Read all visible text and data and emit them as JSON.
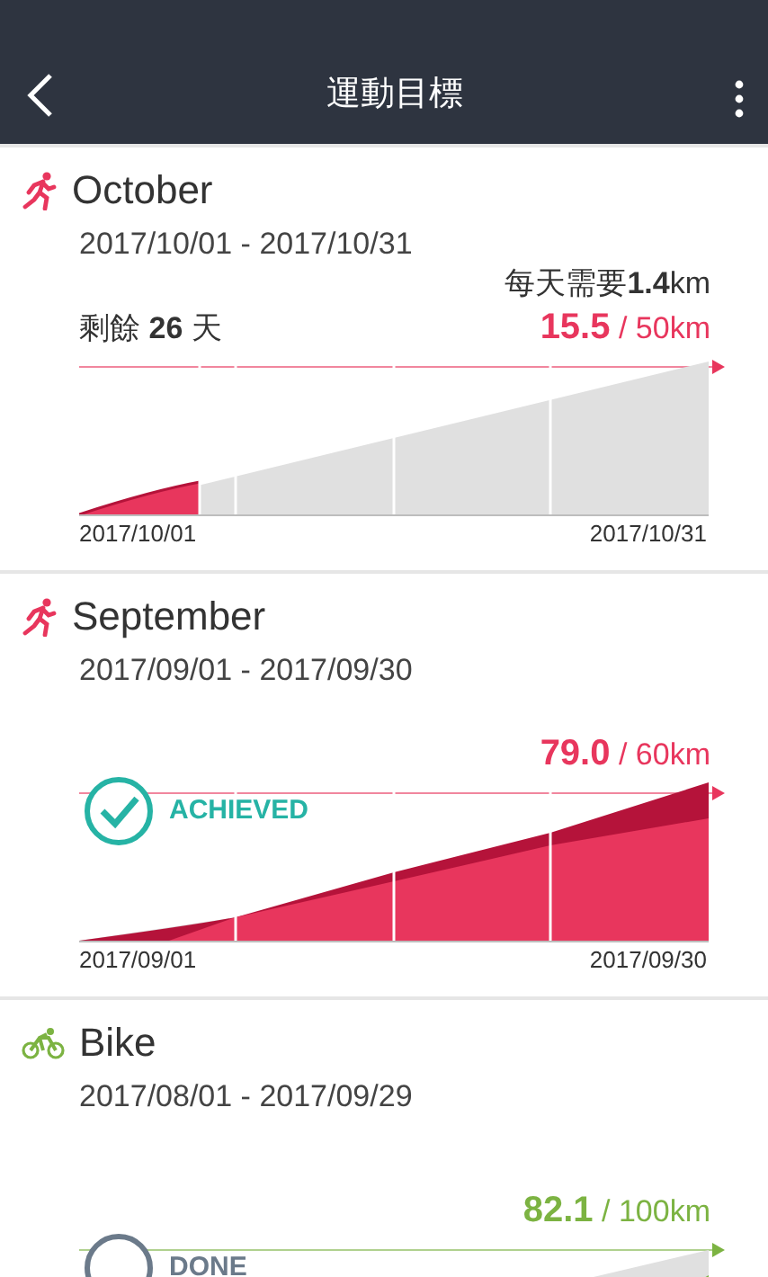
{
  "header": {
    "title": "運動目標"
  },
  "goals": [
    {
      "kind": "run",
      "color": "#e8365d",
      "name": "October",
      "dates": "2017/10/01 - 2017/10/31",
      "daily": "每天需要**1.4**km",
      "remaining": "剩餘 **26** 天",
      "current": "15.5",
      "target": " / 50km",
      "chart": {
        "kind": "partial"
      },
      "start": "2017/10/01",
      "end": "2017/10/31"
    },
    {
      "kind": "run",
      "color": "#e8365d",
      "name": "September",
      "dates": "2017/09/01 - 2017/09/30",
      "current": "79.0",
      "target": " / 60km",
      "badge": {
        "kind": "achieved",
        "label": "ACHIEVED"
      },
      "chart": {
        "kind": "exceeded"
      },
      "start": "2017/09/01",
      "end": "2017/09/30"
    },
    {
      "kind": "bike",
      "color": "#7cb342",
      "name": "Bike",
      "dates": "2017/08/01 - 2017/09/29",
      "current": "82.1",
      "target": " / 100km",
      "badge": {
        "kind": "done",
        "label": "DONE"
      },
      "chart": {
        "kind": "cut"
      }
    }
  ]
}
